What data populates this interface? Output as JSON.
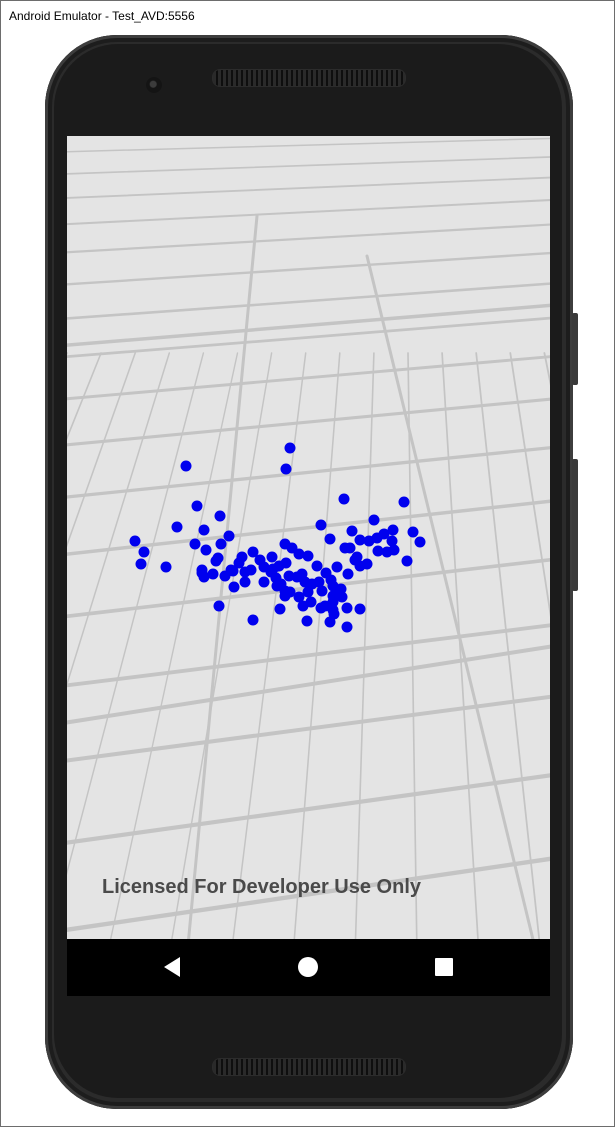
{
  "window": {
    "title": "Android Emulator - Test_AVD:5556"
  },
  "map": {
    "watermark": "Licensed For Developer Use Only",
    "point_color": "#0000ee",
    "background_color": "#e4e4e4",
    "grid_color": "#c4c4c4"
  },
  "navigation_bar": {
    "back_icon": "back-triangle-icon",
    "home_icon": "home-circle-icon",
    "recents_icon": "recents-square-icon"
  }
}
